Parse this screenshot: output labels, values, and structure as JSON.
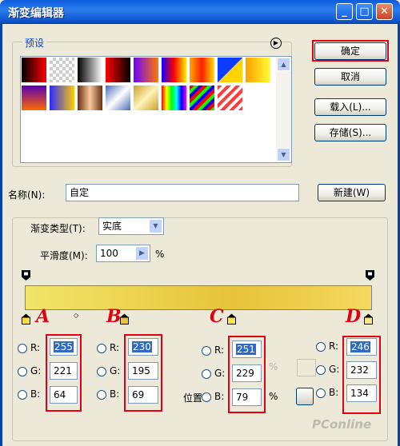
{
  "window": {
    "title": "渐变编辑器"
  },
  "presets": {
    "label": "预设",
    "menu_icon": "circle-arrow-right-icon",
    "swatches": [
      "linear-gradient(90deg,#000,#ff0000)",
      "repeating-conic-gradient(#ccc 0 25%,#fff 0 50%) 0 0/8px 8px, linear-gradient(90deg,#ff0000,transparent)",
      "linear-gradient(90deg,#000,#fff)",
      "linear-gradient(90deg,#ff0000,#000)",
      "linear-gradient(90deg,#6a00ff,#ff7a00)",
      "linear-gradient(90deg,#1400ff,#ff0000,#ffee00)",
      "linear-gradient(90deg,#ffa600,#ff1f00,#ffe100)",
      "linear-gradient(135deg,#0b3cff 50%,#ffd400 50%)",
      "linear-gradient(90deg,#ff9f00,#ffff33)",
      "linear-gradient(180deg,#5a00b8,#ff6a00)",
      "linear-gradient(90deg,#2b2bff,#ffcc00)",
      "linear-gradient(90deg,#6b2f12,#f7c89c,#6b2f12)",
      "linear-gradient(135deg,#4b6cb7,#fff,#4b6cb7)",
      "linear-gradient(135deg,#c9a12b,#fff3b8,#c9a12b)",
      "linear-gradient(90deg,#ff0000,#ffff00,#00ff00,#00ffff,#0000ff,#ff00ff)",
      "repeating-linear-gradient(135deg,#ff0000 0 4px,#00ff00 4px 8px,#0000ff 8px 12px)",
      "repeating-linear-gradient(135deg,#ff3b3b 0 4px,#fff 4px 8px)"
    ]
  },
  "buttons": {
    "ok": "确定",
    "cancel": "取消",
    "load": "载入(L)...",
    "save": "存储(S)...",
    "new": "新建(W)"
  },
  "name": {
    "label": "名称(N):",
    "value": "自定"
  },
  "gradient_type": {
    "label": "渐变类型(T):",
    "value": "实底"
  },
  "smoothness": {
    "label": "平滑度(M):",
    "value": "100",
    "unit": "%"
  },
  "gradient_bar": {
    "from": "#f2e56a",
    "mid": "#e6c33a",
    "to": "#f5d85e"
  },
  "annotations": [
    "A",
    "B",
    "C",
    "D"
  ],
  "stops": [
    {
      "label": "A",
      "r": "255",
      "g": "221",
      "b": "64"
    },
    {
      "label": "B",
      "r": "230",
      "g": "195",
      "b": "69"
    },
    {
      "label": "C",
      "r": "251",
      "g": "229",
      "b": "79"
    },
    {
      "label": "D",
      "r": "246",
      "g": "232",
      "b": "134"
    }
  ],
  "channel_labels": {
    "r": "R:",
    "g": "G:",
    "b": "B:"
  },
  "position_label": "位置",
  "percent": "%",
  "watermark": "PConline"
}
